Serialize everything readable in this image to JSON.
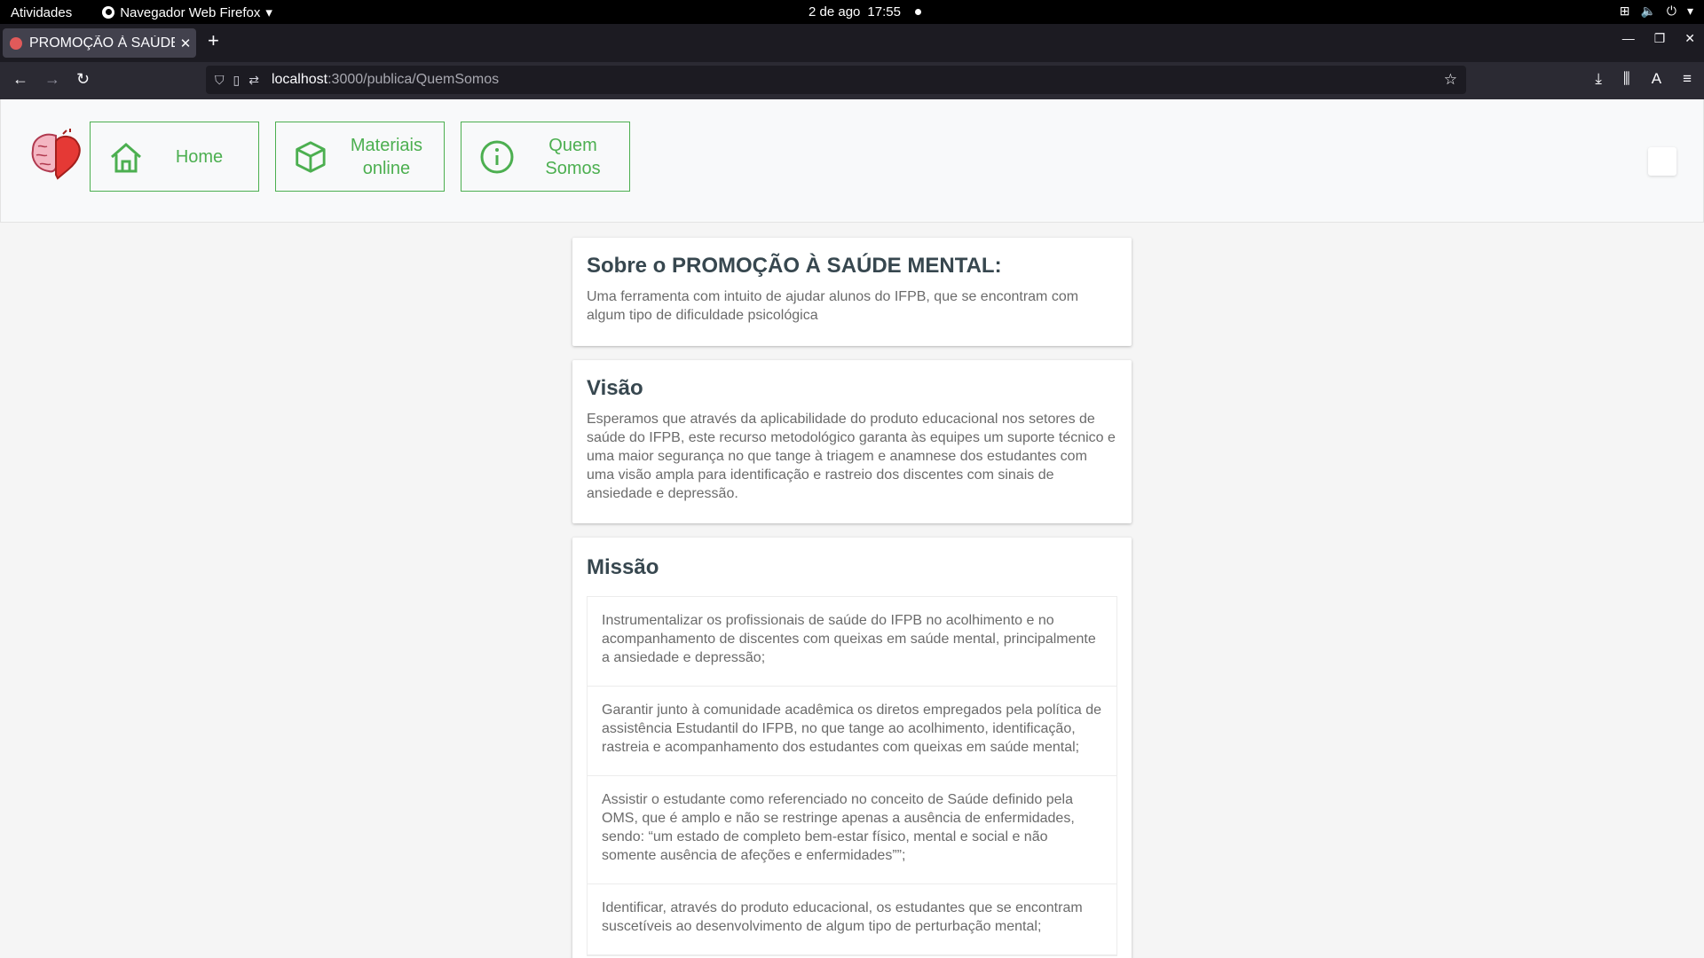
{
  "system_bar": {
    "activities": "Atividades",
    "app_name": "Navegador Web Firefox",
    "date": "2 de ago",
    "time": "17:55"
  },
  "browser": {
    "tab_title": "PROMOÇÃO À SAÚDE",
    "url_host": "localhost",
    "url_path": ":3000/publica/QuemSomos"
  },
  "nav": {
    "items": [
      {
        "label": "Home",
        "icon": "home-icon"
      },
      {
        "label": "Materiais online",
        "icon": "box-icon"
      },
      {
        "label": "Quem Somos",
        "icon": "info-icon"
      }
    ]
  },
  "about": {
    "title": "Sobre o PROMOÇÃO À SAÚDE MENTAL:",
    "text": "Uma ferramenta com intuito de ajudar alunos do IFPB, que se encontram com algum tipo de dificuldade psicológica"
  },
  "vision": {
    "title": "Visão",
    "text": "Esperamos que através da aplicabilidade do produto educacional nos setores de saúde do IFPB, este recurso metodológico garanta às equipes um suporte técnico e uma maior segurança no que tange à triagem e anamnese dos estudantes com uma visão ampla para identificação e rastreio dos discentes com sinais de ansiedade e depressão."
  },
  "mission": {
    "title": "Missão",
    "items": [
      "Instrumentalizar os profissionais de saúde do IFPB no acolhimento e no acompanhamento de discentes com queixas em saúde mental, principalmente a ansiedade e depressão;",
      "Garantir junto à comunidade acadêmica os diretos empregados pela política de assistência Estudantil do IFPB, no que tange ao acolhimento, identificação, rastreia e acompanhamento dos estudantes com queixas em saúde mental;",
      "Assistir o estudante como referenciado no conceito de Saúde definido pela OMS, que é amplo e não se restringe apenas a ausência de enfermidades, sendo: “um estado de completo bem-estar físico, mental e social e não somente ausência de afeções e enfermidades””;",
      "Identificar, através do produto educacional, os estudantes que se encontram suscetíveis ao desenvolvimento de algum tipo de perturbação mental;"
    ]
  },
  "colors": {
    "accent": "#4caf50",
    "heading": "#37474f",
    "body_text": "#6b6b6b"
  }
}
